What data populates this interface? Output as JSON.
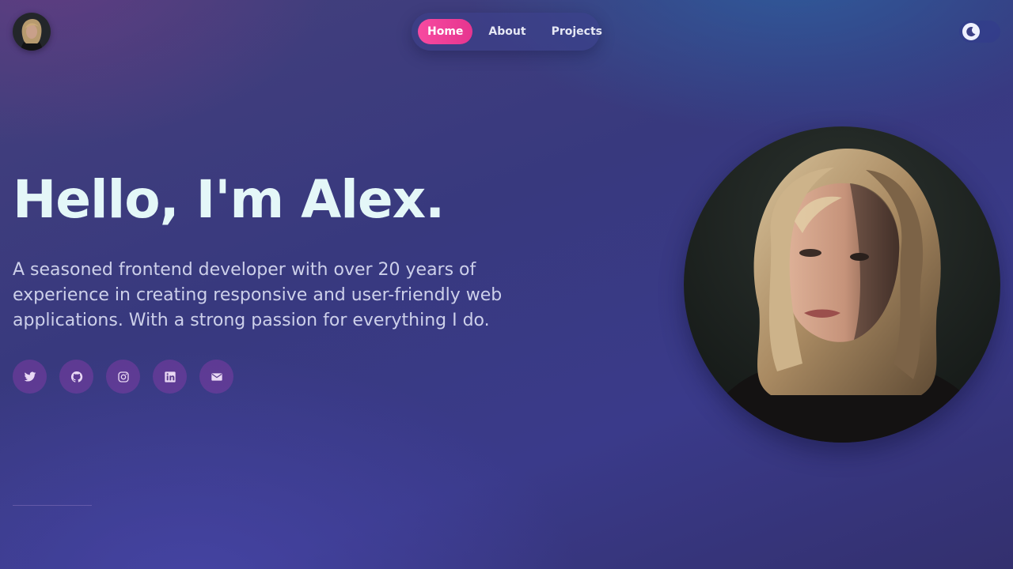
{
  "header": {
    "nav": [
      {
        "label": "Home",
        "active": true
      },
      {
        "label": "About",
        "active": false
      },
      {
        "label": "Projects",
        "active": false
      }
    ],
    "theme_toggle_icon": "moon-icon"
  },
  "hero": {
    "title": "Hello, I'm Alex.",
    "description": "A seasoned frontend developer with over 20 years of experience in creating responsive and user-friendly web applications. With a strong passion for everything I do."
  },
  "socials": [
    {
      "icon": "twitter-icon"
    },
    {
      "icon": "github-icon"
    },
    {
      "icon": "instagram-icon"
    },
    {
      "icon": "linkedin-icon"
    },
    {
      "icon": "email-icon"
    }
  ],
  "colors": {
    "accent": "#f74aa0",
    "title": "#e4f7f8",
    "text": "#cdd0ea"
  }
}
